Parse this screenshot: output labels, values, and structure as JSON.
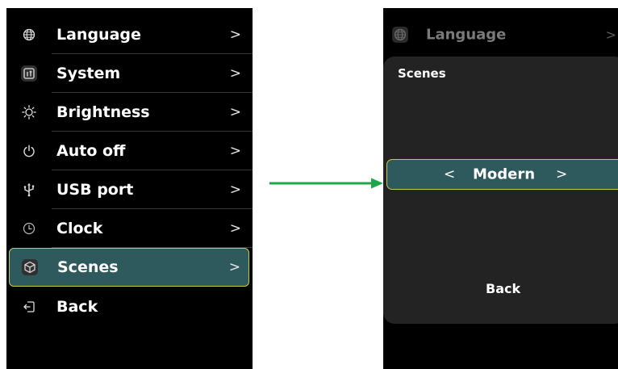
{
  "menu": {
    "items": [
      {
        "label": "Language",
        "icon": "globe-icon",
        "chevron": ">"
      },
      {
        "label": "System",
        "icon": "system-icon",
        "chevron": ">"
      },
      {
        "label": "Brightness",
        "icon": "sun-icon",
        "chevron": ">"
      },
      {
        "label": "Auto off",
        "icon": "power-icon",
        "chevron": ">"
      },
      {
        "label": "USB port",
        "icon": "usb-icon",
        "chevron": ">"
      },
      {
        "label": "Clock",
        "icon": "clock-icon",
        "chevron": ">"
      },
      {
        "label": "Scenes",
        "icon": "cube-icon",
        "chevron": ">"
      },
      {
        "label": "Back",
        "icon": "exit-icon"
      }
    ],
    "selected_index": 6
  },
  "detail": {
    "background_item": {
      "label": "Language",
      "icon": "globe-icon",
      "chevron": ">"
    },
    "dialog_title": "Scenes",
    "picker": {
      "prev": "<",
      "value": "Modern",
      "next": ">"
    },
    "back_label": "Back"
  },
  "colors": {
    "background": "#000000",
    "highlight": "#2e5a5e",
    "focus_border": "#c9cc3a",
    "arrow": "#1fa64a",
    "dialog": "#232323"
  }
}
